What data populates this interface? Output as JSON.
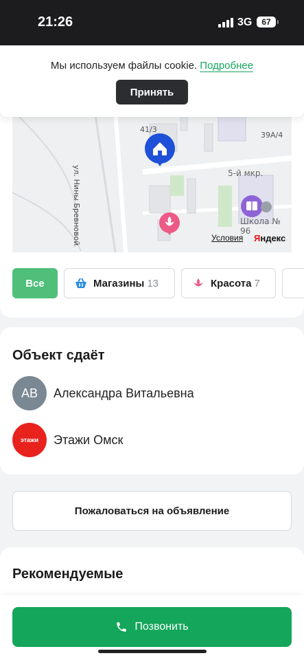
{
  "status_bar": {
    "time": "21:26",
    "network": "3G",
    "battery": "67"
  },
  "cookie": {
    "text": "Мы используем файлы cookie.",
    "link": "Подробнее",
    "accept": "Принять"
  },
  "map": {
    "street": "ул. Нины Бревновой",
    "labels": {
      "building_41_3": "41/3",
      "building_39a_4": "39А/4",
      "district": "5-й мкр.",
      "school": "Школа № 96"
    },
    "terms": "Условия",
    "logo_first": "Я",
    "logo_rest": "ндекс"
  },
  "filters": [
    {
      "label": "Все",
      "count": ""
    },
    {
      "label": "Магазины",
      "count": "13"
    },
    {
      "label": "Красота",
      "count": "7"
    }
  ],
  "owner": {
    "title": "Объект сдаёт",
    "people": [
      {
        "initials": "АВ",
        "name": "Александра Витальевна"
      },
      {
        "logo_text": "этажи",
        "name": "Этажи Омск"
      }
    ]
  },
  "complain_label": "Пожаловаться на объявление",
  "recommended_title": "Рекомендуемые",
  "call_label": "Позвонить",
  "colors": {
    "accent": "#14a65b",
    "chip_active": "#4fbf79",
    "agency_red": "#e8231e"
  }
}
